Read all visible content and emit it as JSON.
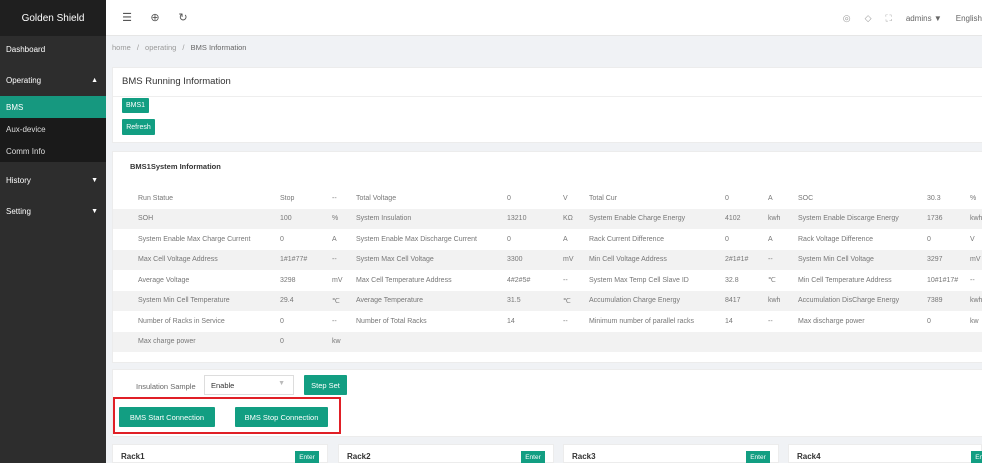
{
  "app": {
    "title": "Golden Shield"
  },
  "sidebar": {
    "items": [
      {
        "label": "Dashboard"
      },
      {
        "label": "Operating"
      },
      {
        "label": "BMS"
      },
      {
        "label": "Aux-device"
      },
      {
        "label": "Comm Info"
      },
      {
        "label": "History"
      },
      {
        "label": "Setting"
      }
    ]
  },
  "topbar": {
    "user": "admins",
    "language": "English",
    "icons": [
      "menu-fold-icon",
      "globe-icon",
      "refresh-icon",
      "palette-icon",
      "tag-icon",
      "fullscreen-icon"
    ]
  },
  "breadcrumb": {
    "home": "home",
    "section": "operating",
    "page": "BMS Information"
  },
  "main": {
    "title": "BMS Running Information",
    "bms_tab": "BMS1",
    "refresh": "Refresh"
  },
  "system": {
    "title": "BMS1System Information",
    "rows": [
      [
        "Run Statue",
        "Stop",
        "--",
        "Total Voltage",
        "0",
        "V",
        "Total Cur",
        "0",
        "A",
        "SOC",
        "30.3",
        "%"
      ],
      [
        "SOH",
        "100",
        "%",
        "System Insulation",
        "13210",
        "KΩ",
        "System Enable Charge Energy",
        "4102",
        "kwh",
        "System Enable Discarge Energy",
        "1736",
        "kwh"
      ],
      [
        "System Enable Max Charge Current",
        "0",
        "A",
        "System Enable Max Discharge Current",
        "0",
        "A",
        "Rack Current Difference",
        "0",
        "A",
        "Rack Voltage Difference",
        "0",
        "V"
      ],
      [
        "Max Cell Voltage Address",
        "1#1#77#",
        "--",
        "System Max Cell Voltage",
        "3300",
        "mV",
        "Min Cell Voltage Address",
        "2#1#1#",
        "--",
        "System Min Cell Voltage",
        "3297",
        "mV"
      ],
      [
        "Average Voltage",
        "3298",
        "mV",
        "Max Cell Temperature Address",
        "4#2#5#",
        "--",
        "System Max Temp Cell Slave ID",
        "32.8",
        "℃",
        "Min Cell Temperature Address",
        "10#1#17#",
        "--"
      ],
      [
        "System Min Cell Temperature",
        "29.4",
        "℃",
        "Average Temperature",
        "31.5",
        "℃",
        "Accumulation Charge Energy",
        "8417",
        "kwh",
        "Accumulation DisCharge Energy",
        "7389",
        "kwh"
      ],
      [
        "Number of Racks in Service",
        "0",
        "--",
        "Number of Total Racks",
        "14",
        "--",
        "Minimum number of parallel racks",
        "14",
        "--",
        "Max discharge power",
        "0",
        "kw"
      ],
      [
        "Max charge power",
        "0",
        "kw",
        "",
        "",
        "",
        "",
        "",
        "",
        "",
        "",
        ""
      ]
    ]
  },
  "insulation": {
    "label": "Insulation Sample",
    "value": "Enable",
    "step_set": "Step Set",
    "start": "BMS Start Connection",
    "stop": "BMS Stop Connection"
  },
  "racks": [
    {
      "name": "Rack1",
      "enter": "Enter"
    },
    {
      "name": "Rack2",
      "enter": "Enter"
    },
    {
      "name": "Rack3",
      "enter": "Enter"
    },
    {
      "name": "Rack4",
      "enter": "Enter"
    }
  ],
  "colors": {
    "accent": "#129e82",
    "sidebar": "#2d2d2d",
    "highlight": "#e01f26"
  }
}
